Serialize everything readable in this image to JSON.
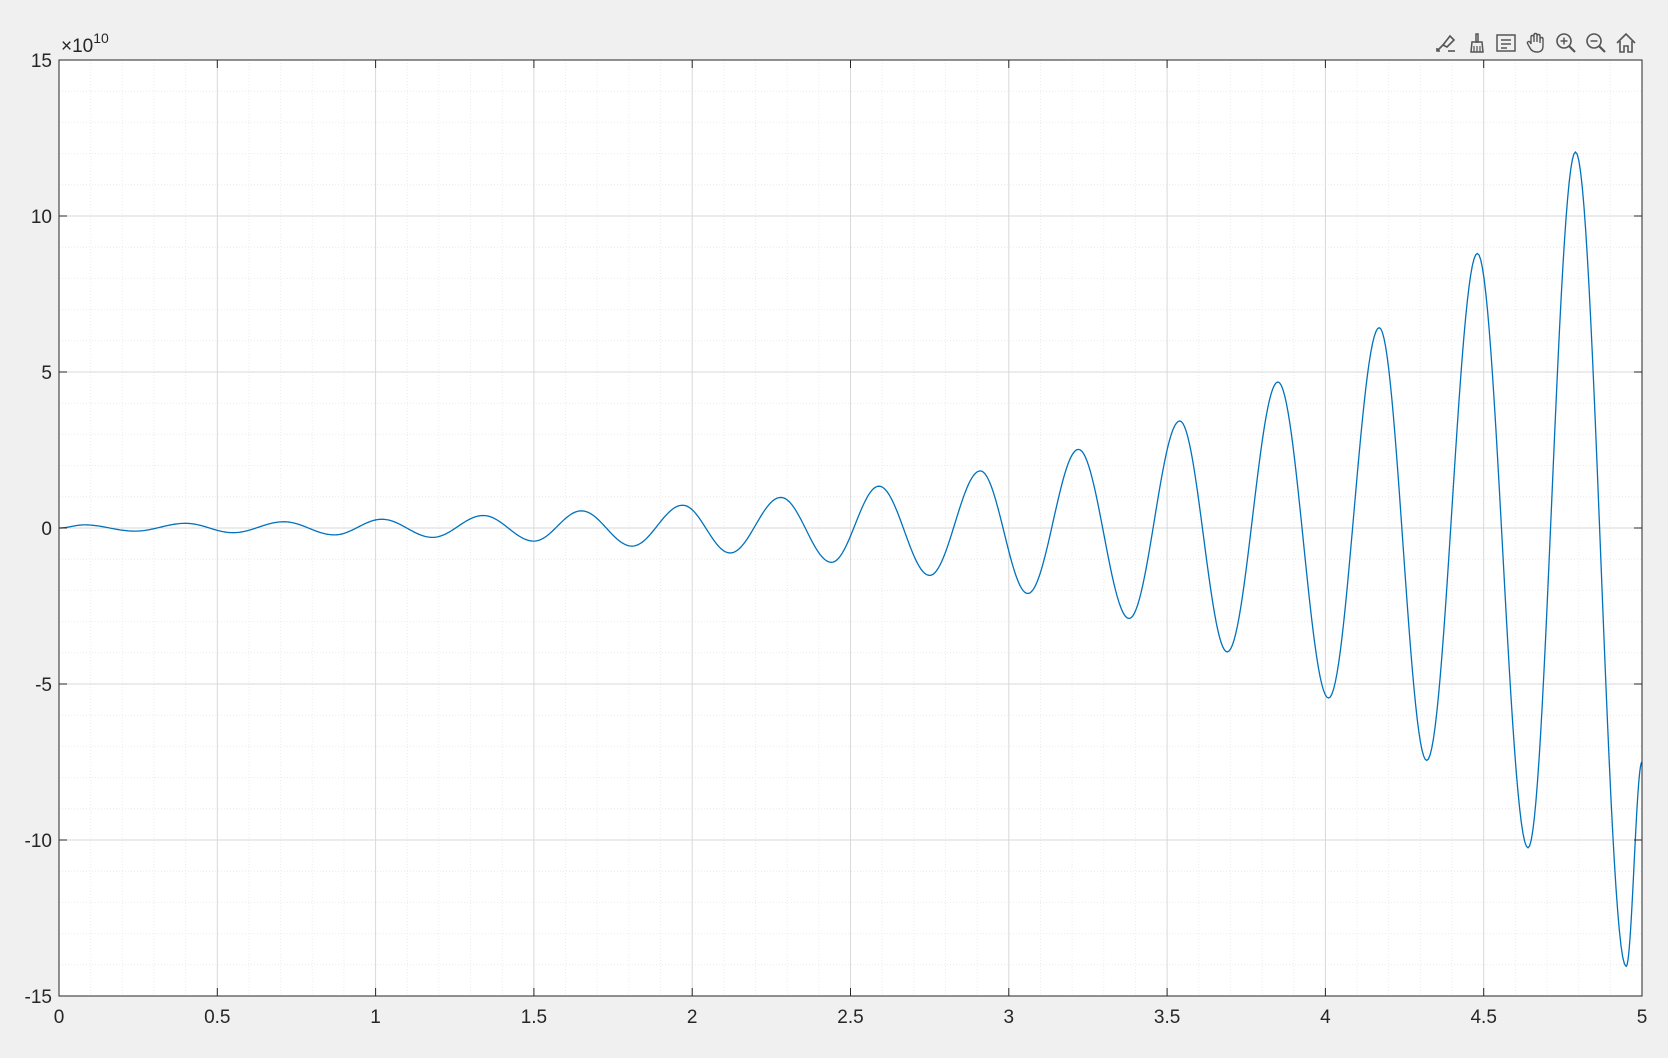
{
  "toolbar": {
    "icons": [
      "data-tips-icon",
      "brush-icon",
      "legend-icon",
      "pan-hand-icon",
      "zoom-in-icon",
      "zoom-out-icon",
      "home-icon"
    ]
  },
  "colors": {
    "line": "#0072bd",
    "grid_major": "#d9d9d9",
    "grid_minor": "#ececec",
    "axes": "#262626",
    "background": "#f0f0f0",
    "plot_area": "#ffffff"
  },
  "chart_data": {
    "type": "line",
    "title": "",
    "xlabel": "",
    "ylabel": "",
    "exponent_label": {
      "base": "×10",
      "power": "10"
    },
    "xlim": [
      0,
      5
    ],
    "ylim": [
      -15,
      15
    ],
    "y_scale_factor": 10000000000.0,
    "grid": "on",
    "minor_grid": "on",
    "legend": "none",
    "x_ticks": [
      0,
      0.5,
      1,
      1.5,
      2,
      2.5,
      3,
      3.5,
      4,
      4.5,
      5
    ],
    "x_tick_labels": [
      "0",
      "0.5",
      "1",
      "1.5",
      "2",
      "2.5",
      "3",
      "3.5",
      "4",
      "4.5",
      "5"
    ],
    "y_ticks": [
      -15,
      -10,
      -5,
      0,
      5,
      10,
      15
    ],
    "y_tick_labels": [
      "-15",
      "-10",
      "-5",
      "0",
      "5",
      "10",
      "15"
    ],
    "series": [
      {
        "extrema": [
          {
            "x": 0.0,
            "y": 0.0
          },
          {
            "x": 0.08,
            "y": 0.1
          },
          {
            "x": 0.24,
            "y": -0.1
          },
          {
            "x": 0.4,
            "y": 0.15
          },
          {
            "x": 0.55,
            "y": -0.15
          },
          {
            "x": 0.71,
            "y": 0.2
          },
          {
            "x": 0.87,
            "y": -0.22
          },
          {
            "x": 1.02,
            "y": 0.28
          },
          {
            "x": 1.18,
            "y": -0.3
          },
          {
            "x": 1.34,
            "y": 0.4
          },
          {
            "x": 1.5,
            "y": -0.42
          },
          {
            "x": 1.65,
            "y": 0.55
          },
          {
            "x": 1.81,
            "y": -0.58
          },
          {
            "x": 1.97,
            "y": 0.73
          },
          {
            "x": 2.12,
            "y": -0.8
          },
          {
            "x": 2.28,
            "y": 0.98
          },
          {
            "x": 2.44,
            "y": -1.1
          },
          {
            "x": 2.59,
            "y": 1.34
          },
          {
            "x": 2.75,
            "y": -1.52
          },
          {
            "x": 2.91,
            "y": 1.83
          },
          {
            "x": 3.06,
            "y": -2.1
          },
          {
            "x": 3.22,
            "y": 2.52
          },
          {
            "x": 3.38,
            "y": -2.9
          },
          {
            "x": 3.54,
            "y": 3.43
          },
          {
            "x": 3.69,
            "y": -3.97
          },
          {
            "x": 3.85,
            "y": 4.68
          },
          {
            "x": 4.01,
            "y": -5.45
          },
          {
            "x": 4.17,
            "y": 6.42
          },
          {
            "x": 4.32,
            "y": -7.45
          },
          {
            "x": 4.48,
            "y": 8.8
          },
          {
            "x": 4.64,
            "y": -10.25
          },
          {
            "x": 4.79,
            "y": 12.05
          },
          {
            "x": 4.95,
            "y": -14.05
          },
          {
            "x": 5.0,
            "y": -7.5
          }
        ]
      }
    ]
  }
}
